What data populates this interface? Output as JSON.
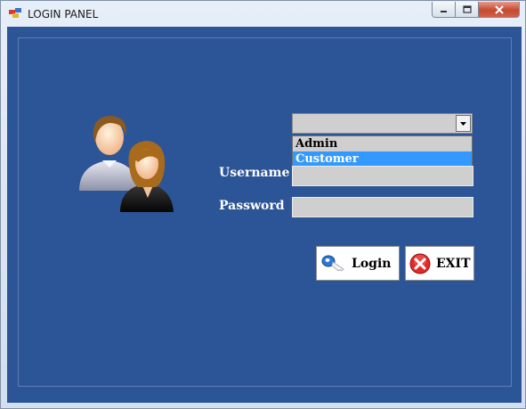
{
  "window": {
    "title": "LOGIN PANEL"
  },
  "role_combo": {
    "options": [
      "Admin",
      "Customer"
    ],
    "highlighted": "Customer"
  },
  "form": {
    "username_label": "Username",
    "password_label": "Password"
  },
  "buttons": {
    "login": "Login",
    "exit": "EXIT"
  },
  "colors": {
    "background": "#2c5597",
    "field": "#cfcfcf",
    "highlight": "#3399ff"
  }
}
